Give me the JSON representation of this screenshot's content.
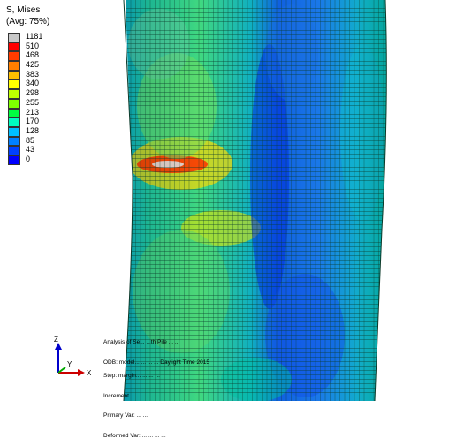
{
  "legend": {
    "title": "S, Mises",
    "subtitle": "(Avg: 75%)",
    "entries": [
      {
        "label": "1181",
        "color": "#c8c8c8"
      },
      {
        "label": "510",
        "color": "#ff0000"
      },
      {
        "label": "468",
        "color": "#ff3c00"
      },
      {
        "label": "425",
        "color": "#ff7f00"
      },
      {
        "label": "383",
        "color": "#ffbf00"
      },
      {
        "label": "340",
        "color": "#ffff00"
      },
      {
        "label": "298",
        "color": "#bfff00"
      },
      {
        "label": "255",
        "color": "#7fff00"
      },
      {
        "label": "213",
        "color": "#00ff40"
      },
      {
        "label": "170",
        "color": "#00ffbf"
      },
      {
        "label": "128",
        "color": "#00bfff"
      },
      {
        "label": "85",
        "color": "#0080ff"
      },
      {
        "label": "43",
        "color": "#0040ff"
      },
      {
        "label": "0",
        "color": "#0000ff"
      }
    ]
  },
  "info_top": [
    "Analysis of Se... ...th Pile ... ...",
    "ODB: model... ... ... ... Daylight Time 2015"
  ],
  "info_bottom": [
    "Step: margin... ... ... ...",
    "Increment ... ... ... ...",
    "Primary Var: ... ...",
    "Deformed Var: ... ... ... ..."
  ],
  "triad": {
    "z": "Z",
    "y": "Y",
    "x": "X"
  },
  "colors": {
    "mesh_lines": "#0a3a2a",
    "background": "#ffffff"
  }
}
